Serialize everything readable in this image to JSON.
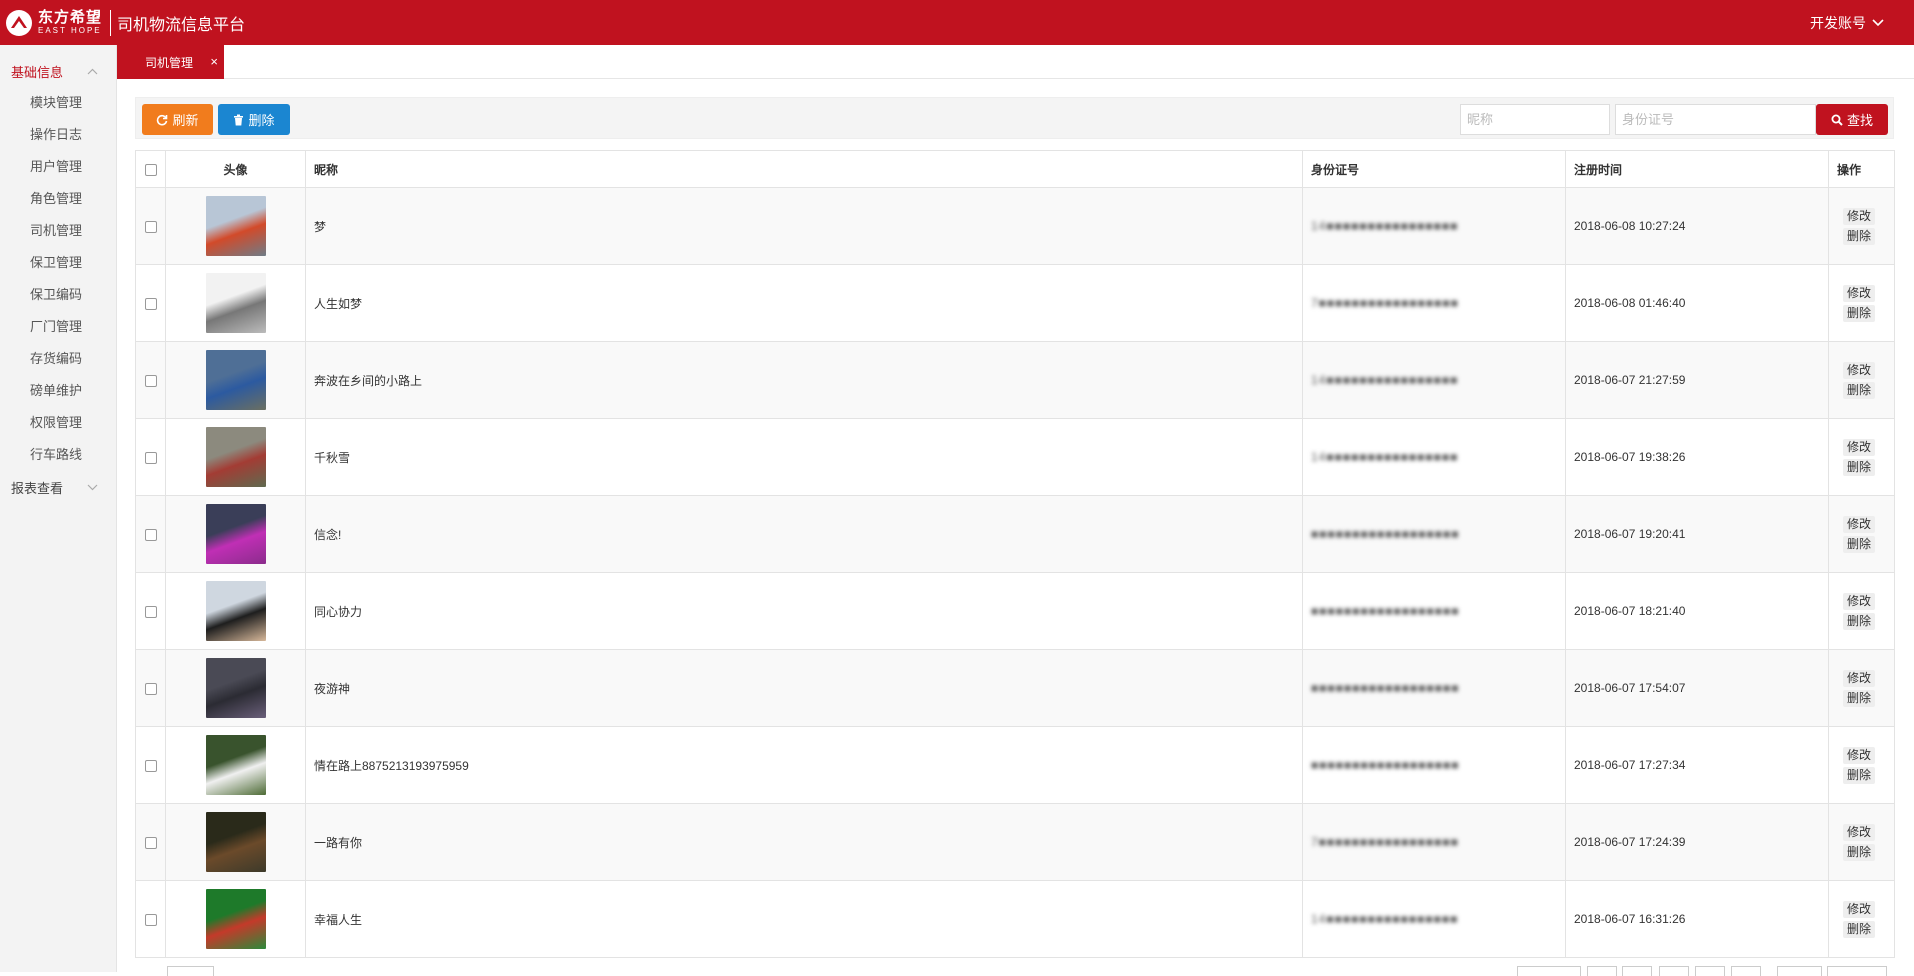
{
  "header": {
    "logo_cn": "东方希望",
    "logo_en": "EAST HOPE",
    "app_title": "司机物流信息平台",
    "account_label": "开发账号"
  },
  "sidebar": {
    "group_basic": "基础信息",
    "items": [
      {
        "label": "模块管理"
      },
      {
        "label": "操作日志"
      },
      {
        "label": "用户管理"
      },
      {
        "label": "角色管理"
      },
      {
        "label": "司机管理"
      },
      {
        "label": "保卫管理"
      },
      {
        "label": "保卫编码"
      },
      {
        "label": "厂门管理"
      },
      {
        "label": "存货编码"
      },
      {
        "label": "磅单维护"
      },
      {
        "label": "权限管理"
      },
      {
        "label": "行车路线"
      }
    ],
    "group_reports": "报表查看"
  },
  "tabs": [
    {
      "label": "司机管理",
      "close": "×"
    }
  ],
  "toolbar": {
    "refresh_label": "刷新",
    "delete_label": "删除",
    "nickname_placeholder": "昵称",
    "idcard_placeholder": "身份证号",
    "search_label": "查找"
  },
  "table": {
    "headers": {
      "avatar": "头像",
      "nickname": "昵称",
      "idcard": "身份证号",
      "registered": "注册时间",
      "action": "操作"
    },
    "edit_label": "修改",
    "delete_label": "删除",
    "rows": [
      {
        "nickname": "梦",
        "idcard": "14■■■■■■■■■■■■■■■■",
        "registered": "2018-06-08 10:27:24",
        "avatar_colors": [
          "#b8c6d6",
          "#d24a2a",
          "#6f7c87"
        ]
      },
      {
        "nickname": "人生如梦",
        "idcard": "7■■■■■■■■■■■■■■■■■",
        "registered": "2018-06-08 01:46:40",
        "avatar_colors": [
          "#f2f2f2",
          "#777777",
          "#bcbcbc"
        ]
      },
      {
        "nickname": "奔波在乡间的小路上",
        "idcard": "14■■■■■■■■■■■■■■■■",
        "registered": "2018-06-07 21:27:59",
        "avatar_colors": [
          "#4f6f96",
          "#2c5aa0",
          "#6b6f61"
        ]
      },
      {
        "nickname": "千秋雪",
        "idcard": "14■■■■■■■■■■■■■■■■",
        "registered": "2018-06-07 19:38:26",
        "avatar_colors": [
          "#8c8a7e",
          "#a33c34",
          "#5f6a4f"
        ]
      },
      {
        "nickname": "信念!",
        "idcard": "■■■■■■■■■■■■■■■■■■",
        "registered": "2018-06-07 19:20:41",
        "avatar_colors": [
          "#3a3e58",
          "#c02fb5",
          "#8b2c8c"
        ]
      },
      {
        "nickname": "同心协力",
        "idcard": "■■■■■■■■■■■■■■■■■■",
        "registered": "2018-06-07 18:21:40",
        "avatar_colors": [
          "#cfd7e0",
          "#1e1e1e",
          "#d7b89a"
        ]
      },
      {
        "nickname": "夜游神",
        "idcard": "■■■■■■■■■■■■■■■■■■",
        "registered": "2018-06-07 17:54:07",
        "avatar_colors": [
          "#4a4a55",
          "#2b2b33",
          "#6a5f7a"
        ]
      },
      {
        "nickname": "情在路上8875213193975959",
        "idcard": "■■■■■■■■■■■■■■■■■■",
        "registered": "2018-06-07 17:27:34",
        "avatar_colors": [
          "#39532d",
          "#f0f0f0",
          "#4d6b35"
        ]
      },
      {
        "nickname": "一路有你",
        "idcard": "7■■■■■■■■■■■■■■■■■",
        "registered": "2018-06-07 17:24:39",
        "avatar_colors": [
          "#2a2a1a",
          "#6b4a2a",
          "#3d3a2a"
        ]
      },
      {
        "nickname": "幸福人生",
        "idcard": "14■■■■■■■■■■■■■■■■",
        "registered": "2018-06-07 16:31:26",
        "avatar_colors": [
          "#1e7a2a",
          "#c43a2a",
          "#2b8a3a"
        ]
      }
    ]
  }
}
